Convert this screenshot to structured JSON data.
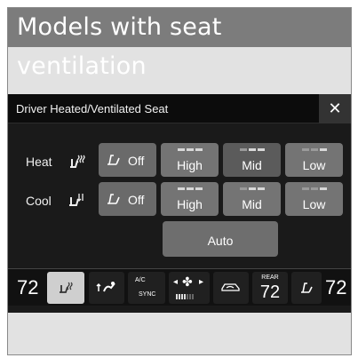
{
  "banner": {
    "title": "Models with seat ventilation"
  },
  "dialog": {
    "title": "Driver Heated/Ventilated Seat",
    "close_label": "✕"
  },
  "heat": {
    "label": "Heat",
    "icon": "heated-seat-icon",
    "off_label": "Off",
    "levels": [
      {
        "label": "High",
        "bars": 3
      },
      {
        "label": "Mid",
        "bars": 2,
        "active": true
      },
      {
        "label": "Low",
        "bars": 1
      }
    ]
  },
  "cool": {
    "label": "Cool",
    "icon": "ventilated-seat-icon",
    "off_label": "Off",
    "levels": [
      {
        "label": "High",
        "bars": 3
      },
      {
        "label": "Mid",
        "bars": 2
      },
      {
        "label": "Low",
        "bars": 1
      }
    ]
  },
  "auto": {
    "label": "Auto"
  },
  "bottom_bar": {
    "driver_temp": "72",
    "ac_label": "A/C",
    "sync_label": "SYNC",
    "rear_label": "REAR",
    "rear_temp": "72",
    "passenger_temp": "72",
    "fan_level": 4,
    "icons": [
      "heated-seat-icon",
      "airflow-mode-icon",
      "fan-icon",
      "recirculation-icon",
      "passenger-seat-icon"
    ]
  },
  "colors": {
    "background": "#e2e2e2",
    "screen": "#1a1a1a",
    "banner": "#7c7c7c",
    "button": "#747474",
    "selected": "#cfcfcf"
  }
}
